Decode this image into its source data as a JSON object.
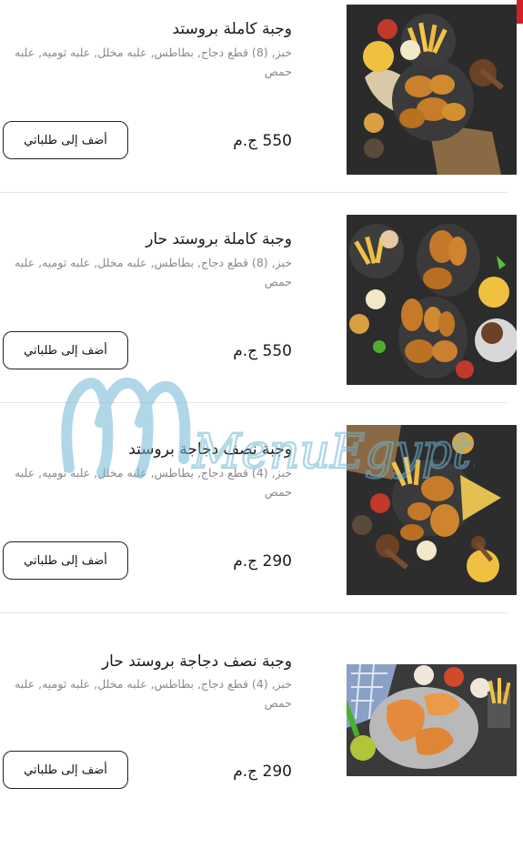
{
  "items": [
    {
      "title": "وجبة كاملة بروستد",
      "description": "خبز, (8) قطع دجاج, بطاطس, علبه مخلل, علبه ثوميه, علبه حمص",
      "price": "550 ج.م",
      "add_button_label": "أضف إلى طلباتي",
      "image_alt": "broasted full meal"
    },
    {
      "title": "وجبة كاملة بروستد حار",
      "description": "خبز, (8) قطع دجاج, بطاطس, علبه مخلل, علبه ثوميه, علبه حمص",
      "price": "550 ج.م",
      "add_button_label": "أضف إلى طلباتي",
      "image_alt": "spicy broasted full meal"
    },
    {
      "title": "وجبة نصف دجاجة بروستد",
      "description": "خبز, (4) قطع دجاج, بطاطس, علبه مخلل, علبه ثوميه, علبه حمص",
      "price": "290 ج.م",
      "add_button_label": "أضف إلى طلباتي",
      "image_alt": "half chicken broasted meal"
    },
    {
      "title": "وجبة نصف دجاجة بروستد حار",
      "description": "خبز, (4) قطع دجاج, بطاطس, علبه مخلل, علبه ثوميه, علبه حمص",
      "price": "290 ج.م",
      "add_button_label": "أضف إلى طلباتي",
      "image_alt": "spicy half chicken broasted meal"
    }
  ],
  "watermark": {
    "text": "MenuEgypt.com"
  },
  "colors": {
    "accent": "#d0202a",
    "watermark": "#6fb8d6",
    "text": "#1a1a1a",
    "muted": "#8a8a8a"
  }
}
